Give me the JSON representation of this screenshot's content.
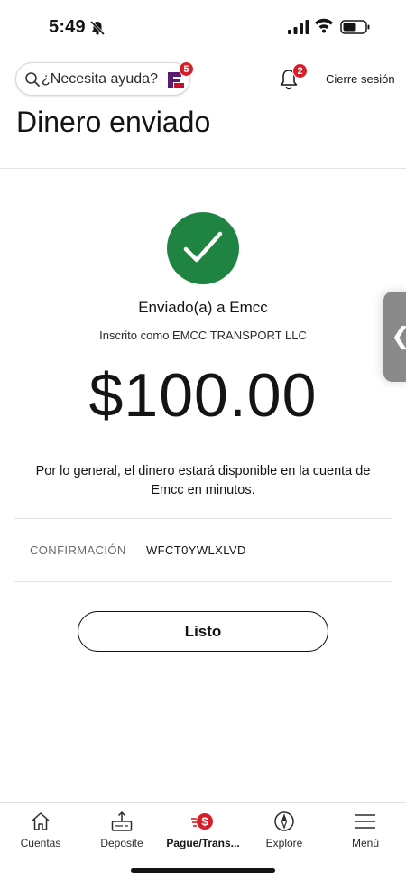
{
  "status_bar": {
    "time": "5:49"
  },
  "header": {
    "search_placeholder": "¿Necesita ayuda?",
    "assistant_badge": "5",
    "notifications_badge": "2",
    "signout_label": "Cierre sesión"
  },
  "page": {
    "title": "Dinero enviado"
  },
  "confirmation": {
    "sent_to": "Enviado(a) a Emcc",
    "enrolled_as": "Inscrito como EMCC TRANSPORT LLC",
    "amount": "$100.00",
    "availability_message": "Por lo general, el dinero estará disponible en la cuenta de Emcc en minutos.",
    "confirmation_label": "CONFIRMACIÓN",
    "confirmation_number": "WFCT0YWLXLVD",
    "done_label": "Listo"
  },
  "bottom_nav": {
    "items": [
      {
        "label": "Cuentas",
        "icon": "home-icon"
      },
      {
        "label": "Deposite",
        "icon": "deposit-icon"
      },
      {
        "label": "Pague/Trans...",
        "icon": "pay-transfer-icon",
        "active": true
      },
      {
        "label": "Explore",
        "icon": "compass-icon"
      },
      {
        "label": "Menú",
        "icon": "menu-icon"
      }
    ]
  },
  "colors": {
    "success_green": "#1f8441",
    "badge_red": "#d71e28",
    "text": "#141414",
    "logo_purple": "#5a1a6e"
  }
}
